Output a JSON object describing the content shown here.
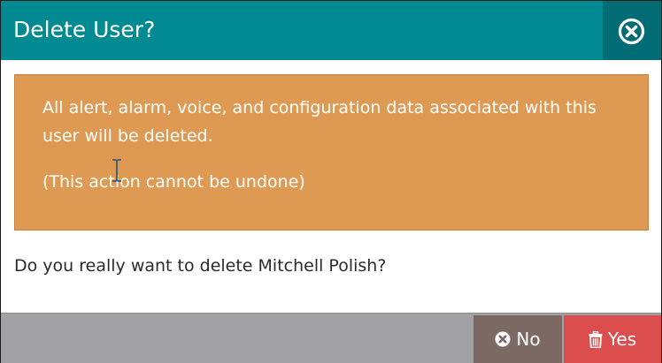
{
  "dialog": {
    "title": "Delete User?",
    "close_icon": "close-circle-icon"
  },
  "warning": {
    "message": "All alert, alarm, voice, and configuration data associated with this user will be deleted.",
    "note": "(This action cannot be undone)",
    "background_color": "#de9a53"
  },
  "question": "Do you really want to delete Mitchell Polish?",
  "buttons": {
    "no_label": "No",
    "no_icon": "times-circle-icon",
    "yes_label": "Yes",
    "yes_icon": "trash-icon"
  },
  "colors": {
    "header": "#018a92",
    "close_button": "#016c73",
    "footer": "#a2a2a4",
    "no_button": "#7d6963",
    "yes_button": "#dc4d4d"
  }
}
